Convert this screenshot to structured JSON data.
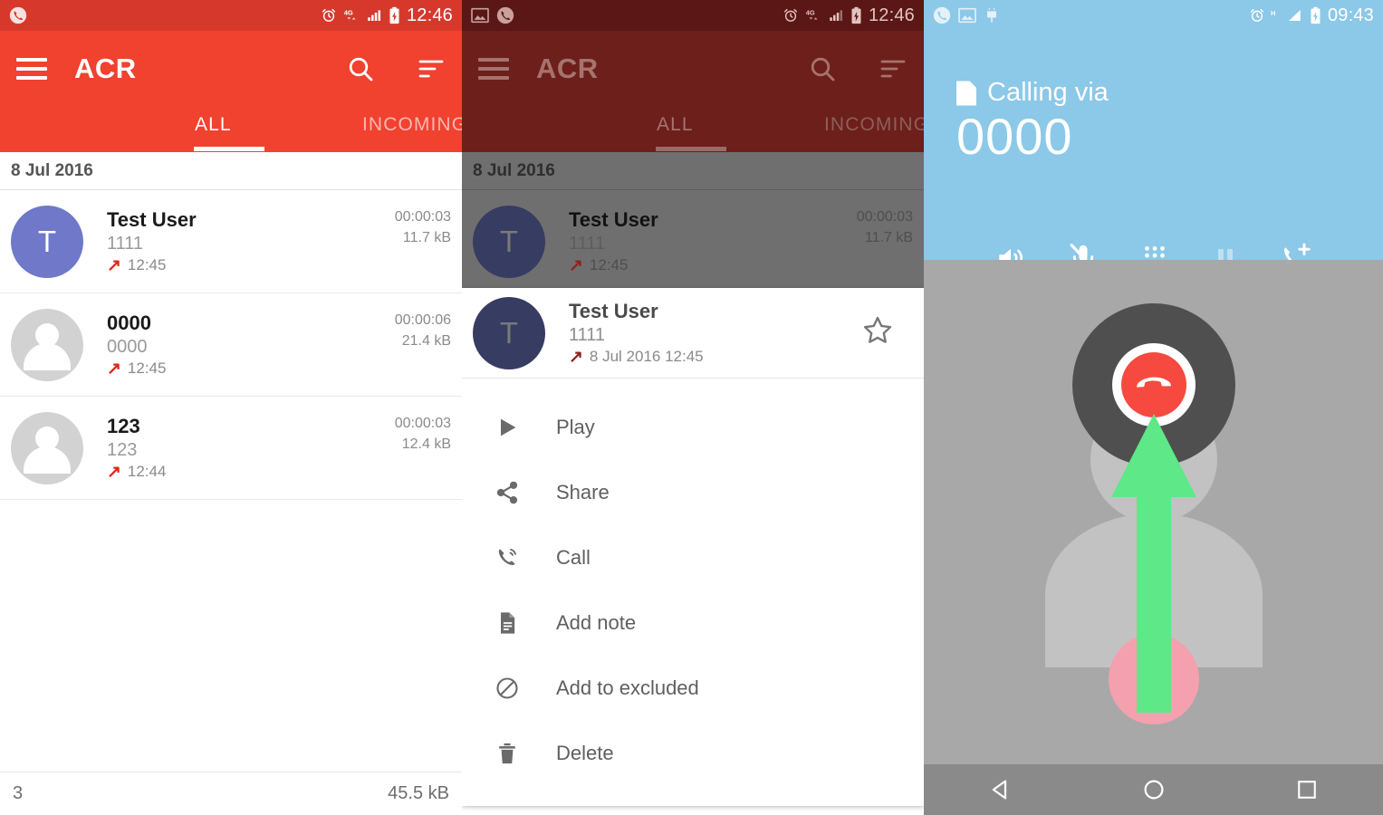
{
  "accent": {
    "app_red": "#f1412f",
    "status_red": "#d6392c",
    "dim_red": "#6d1f1b",
    "call_blue": "#8cc8e8",
    "avatar_blue": "#6f78c9",
    "arrow_green": "#5ee887",
    "end_red": "#f6493f",
    "pink": "#f5a0ae"
  },
  "panel1": {
    "status": {
      "time": "12:46",
      "left_icons": [
        "phone-icon"
      ],
      "right_icons": [
        "alarm-icon",
        "4g-icon",
        "signal-icon",
        "battery-charging-icon"
      ]
    },
    "appbar": {
      "title": "ACR",
      "menu_icon": "hamburger-icon",
      "search_icon": "search-icon",
      "sort_icon": "sort-icon",
      "tabs": [
        {
          "label": "ALL",
          "selected": true
        },
        {
          "label": "INCOMING",
          "selected": false
        }
      ]
    },
    "date_header": "8 Jul 2016",
    "rows": [
      {
        "avatar_letter": "T",
        "avatar_type": "letter",
        "name": "Test User",
        "number": "1111",
        "time": "12:45",
        "direction": "outgoing",
        "duration": "00:00:03",
        "size": "11.7 kB"
      },
      {
        "avatar_letter": "",
        "avatar_type": "generic",
        "name": "0000",
        "number": "0000",
        "time": "12:45",
        "direction": "outgoing",
        "duration": "00:00:06",
        "size": "21.4 kB"
      },
      {
        "avatar_letter": "",
        "avatar_type": "generic",
        "name": "123",
        "number": "123",
        "time": "12:44",
        "direction": "outgoing",
        "duration": "00:00:03",
        "size": "12.4 kB"
      }
    ],
    "footer": {
      "count": "3",
      "total_size": "45.5 kB"
    }
  },
  "panel2": {
    "status": {
      "time": "12:46",
      "left_icons": [
        "image-icon",
        "phone-icon"
      ],
      "right_icons": [
        "alarm-icon",
        "4g-icon",
        "signal-icon",
        "battery-charging-icon"
      ]
    },
    "appbar": {
      "title": "ACR",
      "menu_icon": "hamburger-icon",
      "search_icon": "search-icon",
      "sort_icon": "sort-icon",
      "tabs": [
        {
          "label": "ALL",
          "selected": true
        },
        {
          "label": "INCOMING",
          "selected": false
        }
      ]
    },
    "date_header": "8 Jul 2016",
    "rows": [
      {
        "avatar_letter": "T",
        "avatar_type": "letter",
        "name": "Test User",
        "number": "1111",
        "time": "12:45",
        "direction": "outgoing",
        "duration": "00:00:03",
        "size": "11.7 kB"
      }
    ],
    "dialog": {
      "header": {
        "avatar_letter": "T",
        "name": "Test User",
        "number": "1111",
        "timestamp": "8 Jul 2016 12:45",
        "direction": "outgoing",
        "star_icon": "star-outline-icon"
      },
      "items": [
        {
          "label": "Play",
          "icon": "play-icon"
        },
        {
          "label": "Share",
          "icon": "share-icon"
        },
        {
          "label": "Call",
          "icon": "call-icon"
        },
        {
          "label": "Add note",
          "icon": "note-icon"
        },
        {
          "label": "Add to excluded",
          "icon": "block-icon"
        },
        {
          "label": "Delete",
          "icon": "trash-icon"
        }
      ]
    }
  },
  "panel3": {
    "status": {
      "time": "09:43",
      "left_icons": [
        "phone-icon",
        "image-icon",
        "android-icon"
      ],
      "right_icons": [
        "alarm-icon",
        "hspa-icon",
        "signal-icon",
        "battery-charging-icon"
      ]
    },
    "call": {
      "sim_icon": "sim-card-icon",
      "calling_via_label": "Calling via",
      "number": "0000",
      "actions": [
        {
          "icon": "speaker-icon",
          "name": "speaker"
        },
        {
          "icon": "mic-off-icon",
          "name": "mute"
        },
        {
          "icon": "dialpad-icon",
          "name": "dialpad"
        },
        {
          "icon": "pause-icon",
          "name": "hold",
          "disabled": true
        },
        {
          "icon": "add-call-icon",
          "name": "add-call"
        }
      ],
      "end_call_icon": "end-call-icon",
      "annotation_arrow": "up-arrow-annotation"
    },
    "navbar": [
      {
        "icon": "back-icon",
        "name": "back"
      },
      {
        "icon": "home-icon",
        "name": "home"
      },
      {
        "icon": "recents-icon",
        "name": "recents"
      }
    ]
  }
}
